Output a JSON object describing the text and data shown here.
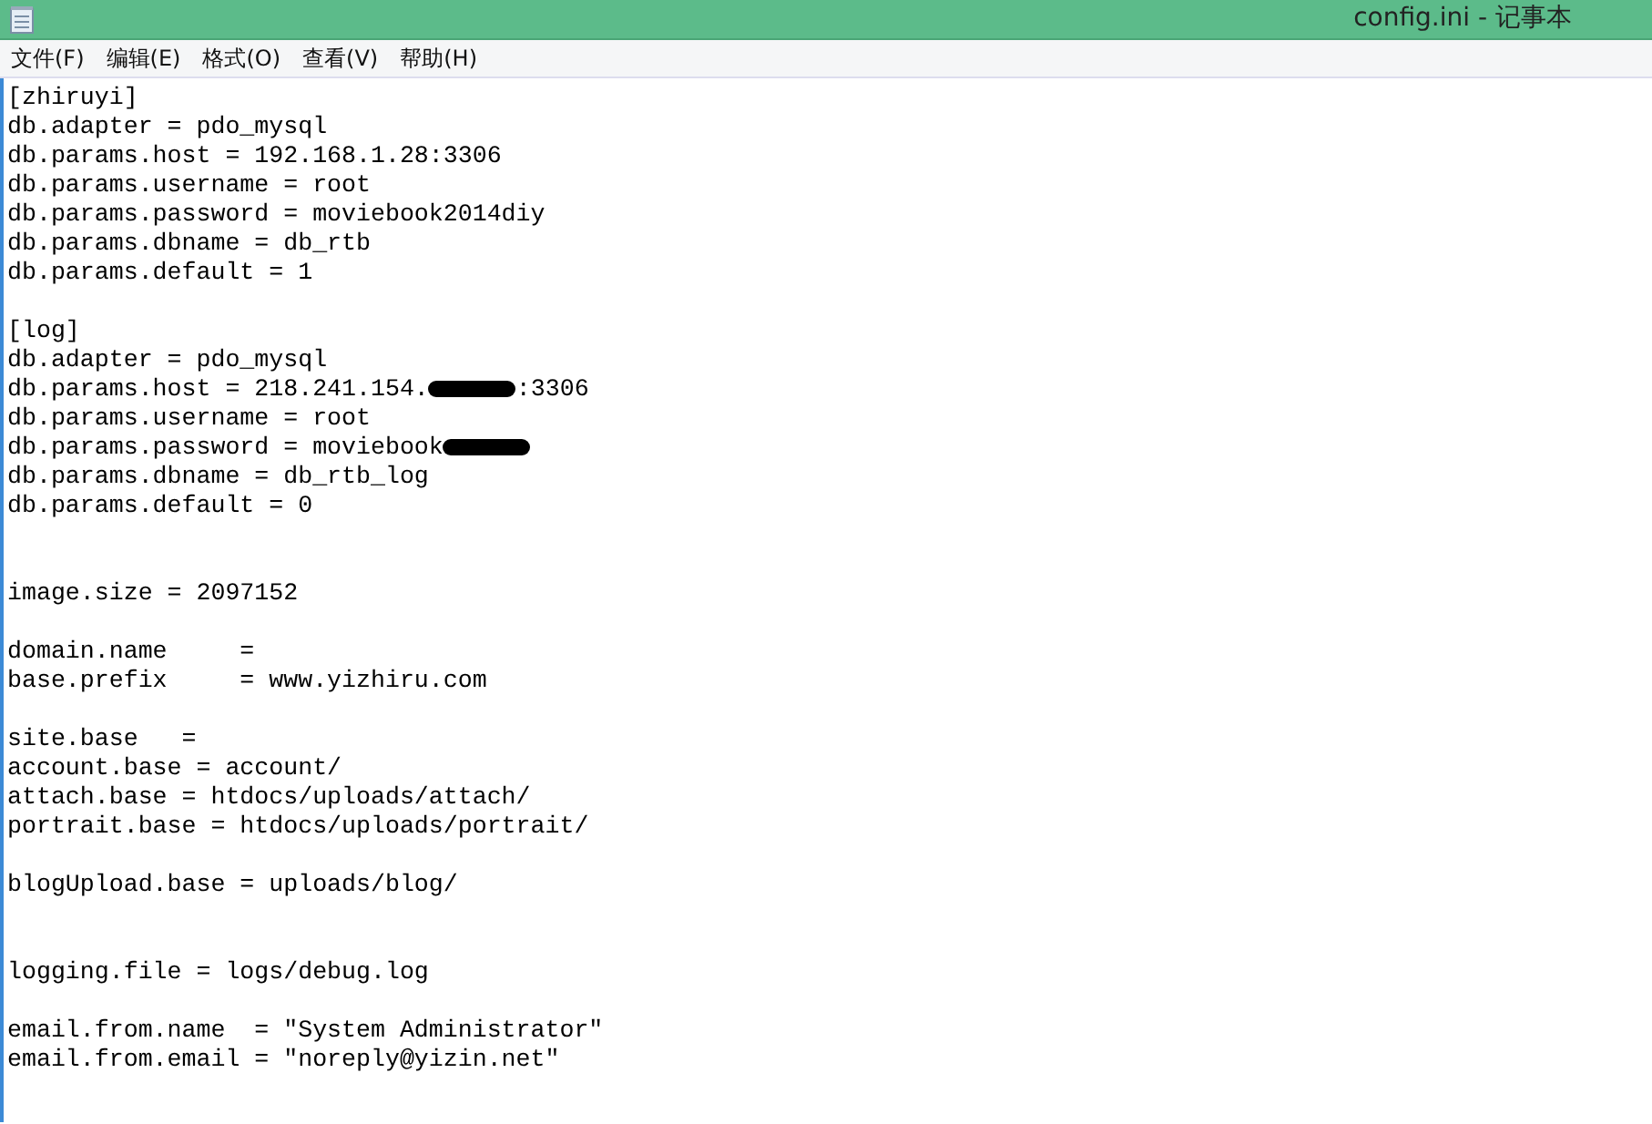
{
  "window": {
    "title": "config.ini - 记事本"
  },
  "menu": [
    "文件(F)",
    "编辑(E)",
    "格式(O)",
    "查看(V)",
    "帮助(H)"
  ],
  "lines": [
    {
      "kind": "text",
      "text": "[zhiruyi]"
    },
    {
      "kind": "text",
      "text": "db.adapter = pdo_mysql"
    },
    {
      "kind": "text",
      "text": "db.params.host = 192.168.1.28:3306"
    },
    {
      "kind": "text",
      "text": "db.params.username = root"
    },
    {
      "kind": "text",
      "text": "db.params.password = moviebook2014diy"
    },
    {
      "kind": "text",
      "text": "db.params.dbname = db_rtb"
    },
    {
      "kind": "text",
      "text": "db.params.default = 1"
    },
    {
      "kind": "blank"
    },
    {
      "kind": "text",
      "text": "[log]"
    },
    {
      "kind": "text",
      "text": "db.adapter = pdo_mysql"
    },
    {
      "kind": "redacted",
      "text": "db.params.host = 218.241.154.",
      "after": ":3306"
    },
    {
      "kind": "text",
      "text": "db.params.username = root"
    },
    {
      "kind": "redacted",
      "text": "db.params.password = moviebook"
    },
    {
      "kind": "text",
      "text": "db.params.dbname = db_rtb_log"
    },
    {
      "kind": "text",
      "text": "db.params.default = 0"
    },
    {
      "kind": "blank"
    },
    {
      "kind": "blank"
    },
    {
      "kind": "text",
      "text": "image.size = 2097152"
    },
    {
      "kind": "blank"
    },
    {
      "kind": "text",
      "text": "domain.name     ="
    },
    {
      "kind": "text",
      "text": "base.prefix     = www.yizhiru.com"
    },
    {
      "kind": "blank"
    },
    {
      "kind": "text",
      "text": "site.base   ="
    },
    {
      "kind": "text",
      "text": "account.base = account/"
    },
    {
      "kind": "text",
      "text": "attach.base = htdocs/uploads/attach/"
    },
    {
      "kind": "text",
      "text": "portrait.base = htdocs/uploads/portrait/"
    },
    {
      "kind": "blank"
    },
    {
      "kind": "text",
      "text": "blogUpload.base = uploads/blog/"
    },
    {
      "kind": "blank"
    },
    {
      "kind": "blank"
    },
    {
      "kind": "text",
      "text": "logging.file = logs/debug.log"
    },
    {
      "kind": "blank"
    },
    {
      "kind": "text",
      "text": "email.from.name  = ″System Administrator″"
    },
    {
      "kind": "text",
      "text": "email.from.email = ″noreply@yizin.net″"
    }
  ]
}
